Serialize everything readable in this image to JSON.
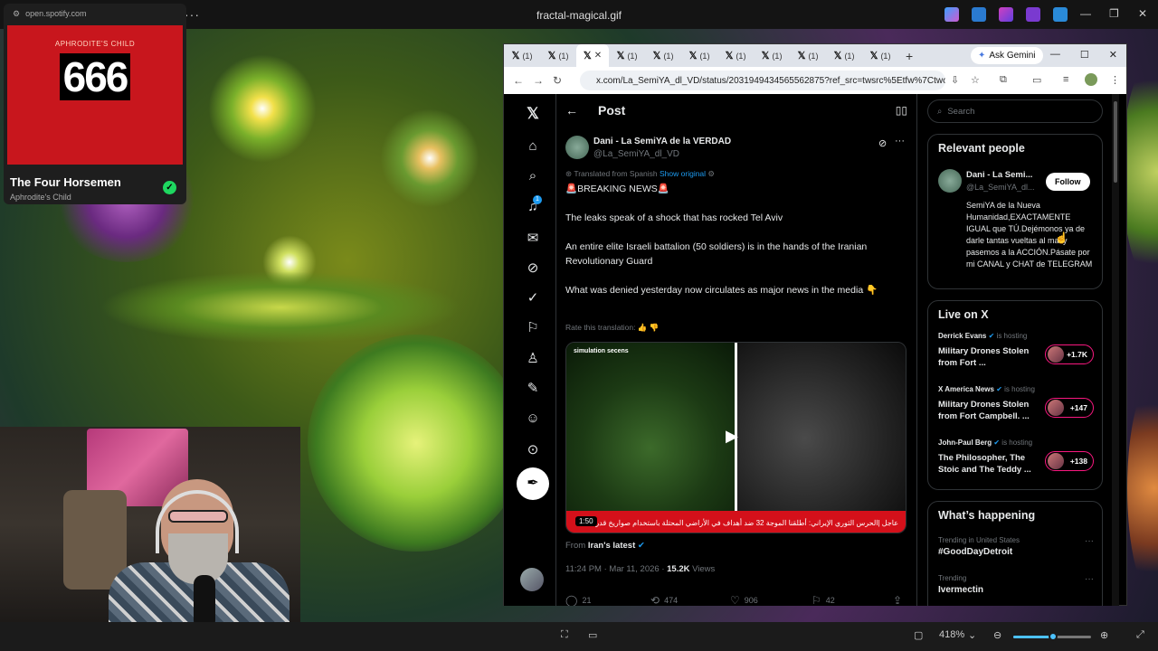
{
  "viewer": {
    "title": "fractal-magical.gif",
    "zoom": "418%"
  },
  "spotify": {
    "url": "open.spotify.com",
    "album_artist": "APHRODITE'S CHILD",
    "album_number": "666",
    "track": "The Four Horsemen",
    "artist": "Aphrodite's Child"
  },
  "browser": {
    "tab_count_label": "(1)",
    "ask_gemini": "Ask Gemini",
    "url": "x.com/La_SemiYA_dl_VD/status/2031949434565562875?ref_src=twsrc%5Etfw%7Ctwcamp%..."
  },
  "post": {
    "header": "Post",
    "author_name": "Dani - La SemiYA de la VERDAD",
    "author_handle": "@La_SemiYA_dl_VD",
    "translated_from": "Translated from Spanish",
    "show_original": "Show original",
    "paragraphs": [
      "🚨BREAKING NEWS🚨",
      "The leaks speak of a shock that has rocked Tel Aviv",
      "An entire elite Israeli battalion (50 soldiers) is in the hands of the Iranian Revolutionary Guard",
      "What was denied yesterday now circulates as major news in the media 👇"
    ],
    "rate_translation": "Rate this translation:",
    "media_caption": "simulation secens",
    "media_duration": "1:50",
    "media_ticker": "عاجل |الحرس الثوري الإيراني: أطلقنا الموجة 32 ضد أهداف في الأراضي المحتلة باستخدام صواريخ قدر",
    "from_label": "From",
    "from_source": "Iran's latest",
    "timestamp": "11:24 PM · Mar 11, 2026 ·",
    "views": "15.2K",
    "views_label": "Views",
    "replies": "21",
    "reposts": "474",
    "likes": "906",
    "bookmarks": "42"
  },
  "sidebar": {
    "search_placeholder": "Search",
    "relevant_title": "Relevant people",
    "rp_name": "Dani - La Semi...",
    "rp_handle": "@La_SemiYA_dl...",
    "follow": "Follow",
    "rp_bio": "SemiYA de la Nueva Humanidad,EXACTAMENTE IGUAL que TÚ.Dejémonos ya de darle tantas vueltas al mal y pasemos a la ACCIÓN.Pásate por mi CANAL y CHAT de TELEGRAM",
    "live_title": "Live on X",
    "hosting_label": "is hosting",
    "live": [
      {
        "host": "Derrick Evans",
        "title": "Military Drones Stolen from Fort ...",
        "count": "+1.7K"
      },
      {
        "host": "X America News",
        "title": "Military Drones Stolen from Fort Campbell. ...",
        "count": "+147"
      },
      {
        "host": "John-Paul Berg",
        "title": "The Philosopher, The Stoic and The Teddy ...",
        "count": "+138"
      }
    ],
    "happening_title": "What’s happening",
    "trends": [
      {
        "context": "Trending in United States",
        "name": "#GoodDayDetroit"
      },
      {
        "context": "Trending",
        "name": "Ivermectin"
      }
    ]
  }
}
